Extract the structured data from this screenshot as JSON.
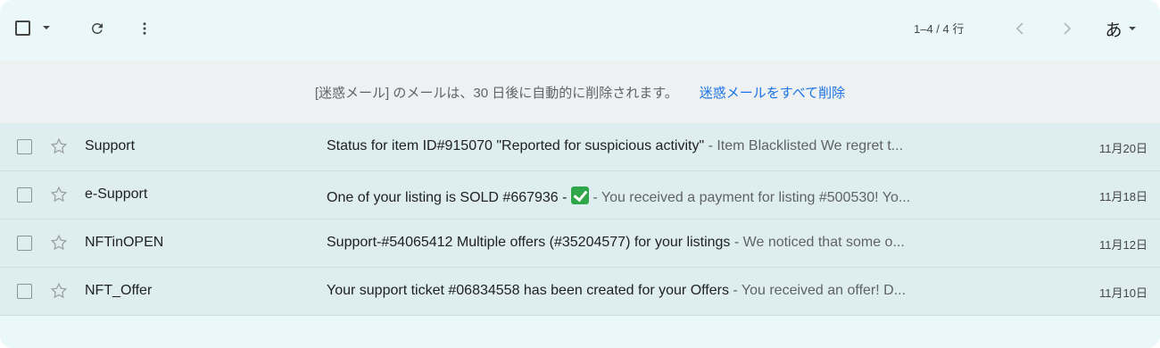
{
  "toolbar": {
    "pager": "1–4 / 4 行",
    "ime_label": "あ",
    "icons": {
      "select": "checkbox-icon",
      "caret": "caret-down-icon",
      "refresh": "refresh-icon",
      "more": "more-vert-icon",
      "prev": "chevron-left-icon",
      "next": "chevron-right-icon"
    }
  },
  "banner": {
    "message": "[迷惑メール] のメールは、30 日後に自動的に削除されます。",
    "action": "迷惑メールをすべて削除"
  },
  "emails": [
    {
      "sender": "Support",
      "subject": "Status for item ID#915070 \"Reported for suspicious activity\"",
      "snippet": "Item Blacklisted We regret t...",
      "date": "11月20日"
    },
    {
      "sender": "e-Support",
      "subject": "One of your listing is SOLD #667936 - ",
      "subject_emoji": "check-mark-icon",
      "snippet": "You received a payment for listing #500530! Yo...",
      "date": "11月18日"
    },
    {
      "sender": "NFTinOPEN",
      "subject": "Support-#54065412 Multiple offers (#35204577) for your listings",
      "snippet": "We noticed that some o...",
      "date": "11月12日"
    },
    {
      "sender": "NFT_Offer",
      "subject": "Your support ticket #06834558 has been created for your Offers",
      "snippet": "You received an offer! D...",
      "date": "11月10日"
    }
  ],
  "separator": " - ",
  "colors": {
    "background": "#eaf8f9",
    "row_background": "#deeef0",
    "link": "#1a73e8"
  }
}
